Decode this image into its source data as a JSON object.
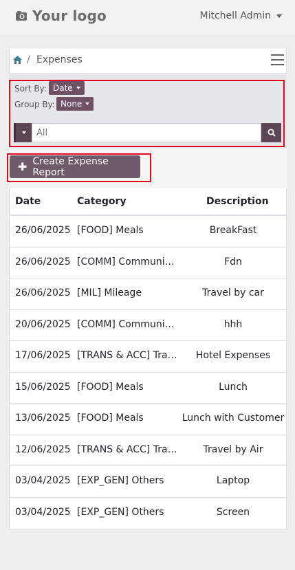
{
  "topbar": {
    "logo_text": "Your logo",
    "user_name": "Mitchell Admin"
  },
  "breadcrumb": {
    "separator": "/",
    "current": "Expenses"
  },
  "filters": {
    "sort_label": "Sort By:",
    "sort_value": "Date",
    "group_label": "Group By:",
    "group_value": "None",
    "search_value": "All"
  },
  "actions": {
    "create_label": "Create Expense Report"
  },
  "table": {
    "headers": [
      "Date",
      "Category",
      "Description"
    ],
    "rows": [
      [
        "26/06/2025",
        "[FOOD] Meals",
        "BreakFast"
      ],
      [
        "26/06/2025",
        "[COMM] Communication",
        "Fdn"
      ],
      [
        "26/06/2025",
        "[MIL] Mileage",
        "Travel by car"
      ],
      [
        "20/06/2025",
        "[COMM] Communication",
        "hhh"
      ],
      [
        "17/06/2025",
        "[TRANS & ACC] Travel",
        "Hotel Expenses"
      ],
      [
        "15/06/2025",
        "[FOOD] Meals",
        "Lunch"
      ],
      [
        "13/06/2025",
        "[FOOD] Meals",
        "Lunch with Customer"
      ],
      [
        "12/06/2025",
        "[TRANS & ACC] Travel",
        "Travel by Air"
      ],
      [
        "03/04/2025",
        "[EXP_GEN] Others",
        "Laptop"
      ],
      [
        "03/04/2025",
        "[EXP_GEN] Others",
        "Screen"
      ]
    ]
  },
  "colors": {
    "accent": "#6f5065",
    "highlight": "#e10a1c"
  }
}
